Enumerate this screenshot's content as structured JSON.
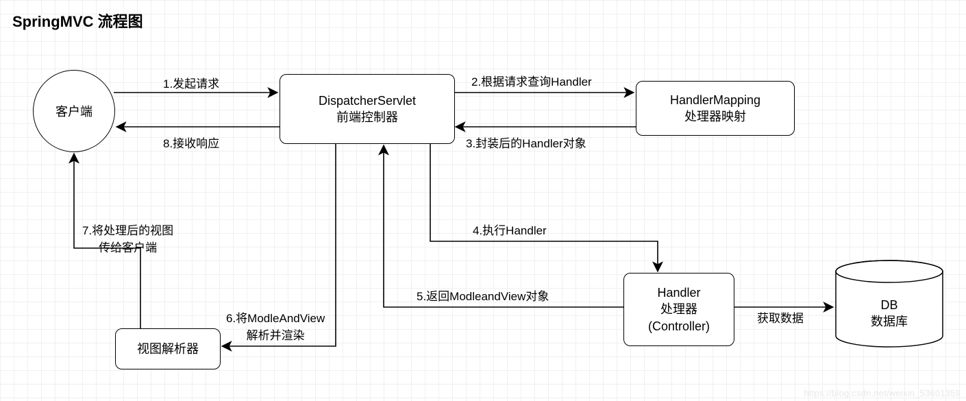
{
  "title": "SpringMVC 流程图",
  "nodes": {
    "client": "客户端",
    "dispatcher_l1": "DispatcherServlet",
    "dispatcher_l2": "前端控制器",
    "mapping_l1": "HandlerMapping",
    "mapping_l2": "处理器映射",
    "handler_l1": "Handler",
    "handler_l2": "处理器",
    "handler_l3": "(Controller)",
    "view": "视图解析器",
    "db_l1": "DB",
    "db_l2": "数据库"
  },
  "edges": {
    "e1": "1.发起请求",
    "e2": "2.根据请求查询Handler",
    "e3": "3.封装后的Handler对象",
    "e4": "4.执行Handler",
    "e5": "5.返回ModleandView对象",
    "e6_l1": "6.将ModleAndView",
    "e6_l2": "解析并渲染",
    "e7_l1": "7.将处理后的视图",
    "e7_l2": "传给客户端",
    "e8": "8.接收响应",
    "edb": "获取数据"
  },
  "watermark": "https://blog.csdn.net/weixin_53601359"
}
